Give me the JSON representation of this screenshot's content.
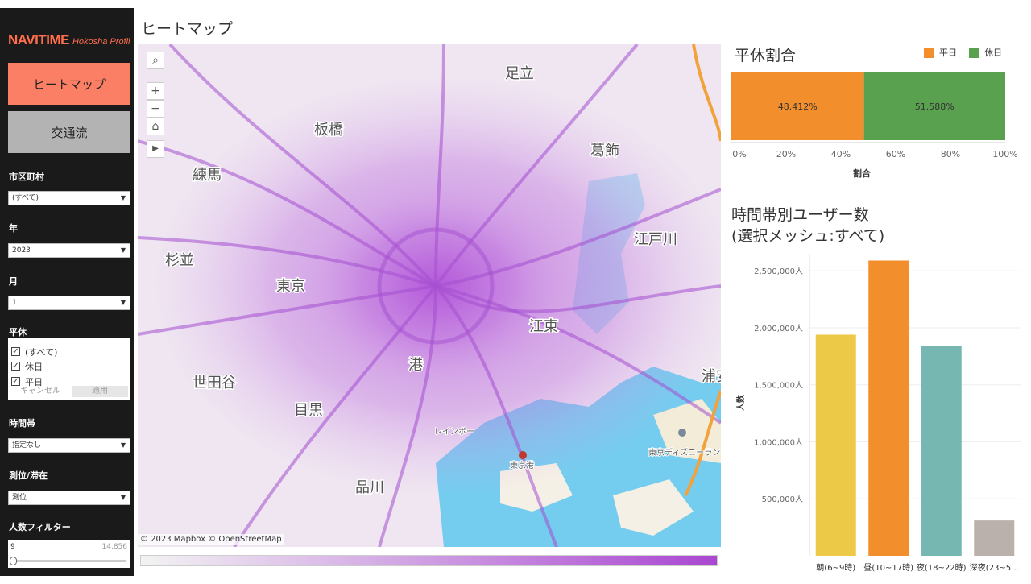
{
  "app": {
    "logo_main": "NAVITIME",
    "logo_sub": "Hokosha Profiler"
  },
  "nav": {
    "heatmap_label": "ヒートマップ",
    "flow_label": "交通流"
  },
  "filters": {
    "municipality": {
      "label": "市区町村",
      "value": "(すべて)"
    },
    "year": {
      "label": "年",
      "value": "2023"
    },
    "month": {
      "label": "月",
      "value": "1"
    },
    "weekday": {
      "label": "平休",
      "options": [
        {
          "label": "(すべて)",
          "checked": true
        },
        {
          "label": "休日",
          "checked": true
        },
        {
          "label": "平日",
          "checked": true
        }
      ],
      "cancel_label": "キャンセル",
      "apply_label": "適用"
    },
    "timeband": {
      "label": "時間帯",
      "value": "指定なし"
    },
    "measure": {
      "label": "測位/滞在",
      "value": "測位"
    },
    "people_filter": {
      "label": "人数フィルター",
      "min": "9",
      "max": "14,856"
    }
  },
  "map": {
    "title": "ヒートマップ",
    "attribution": "© 2023 Mapbox  © OpenStreetMap",
    "place_labels": [
      "足立",
      "板橋",
      "葛飾",
      "練馬",
      "江戸川",
      "杉並",
      "東京",
      "江東",
      "港",
      "世田谷",
      "浦安",
      "目黒",
      "レインボー",
      "東京港",
      "東京ディズニーランド",
      "品川"
    ],
    "legend_colors": {
      "low": "#f3f3f3",
      "high": "#a947d1"
    }
  },
  "ratio_panel": {
    "title": "平休割合",
    "legend": [
      {
        "label": "平日",
        "color": "#f28e2b"
      },
      {
        "label": "休日",
        "color": "#59a14f"
      }
    ],
    "axis_label": "割合",
    "ticks": [
      "0%",
      "20%",
      "40%",
      "60%",
      "80%",
      "100%"
    ],
    "segment_labels": [
      "48.412%",
      "51.588%"
    ]
  },
  "hourly_panel": {
    "title_line1": "時間帯別ユーザー数",
    "title_line2": "(選択メッシュ:すべて)",
    "y_label": "人数",
    "y_ticks": [
      "500,000人",
      "1,000,000人",
      "1,500,000人",
      "2,000,000人",
      "2,500,000人"
    ]
  },
  "chart_data": [
    {
      "type": "bar",
      "orientation": "horizontal-stacked",
      "categories": [
        "平日",
        "休日"
      ],
      "values": [
        48.412,
        51.588
      ],
      "xlabel": "割合",
      "xlim": [
        0,
        100
      ],
      "colors": [
        "#f28e2b",
        "#59a14f"
      ],
      "legend": "top-right"
    },
    {
      "type": "bar",
      "categories": [
        "朝(6~9時)",
        "昼(10~17時)",
        "夜(18~22時)",
        "深夜(23~5..."
      ],
      "values": [
        1940000,
        2590000,
        1840000,
        310000
      ],
      "ylabel": "人数",
      "ylim": [
        0,
        2650000
      ],
      "colors": [
        "#edc948",
        "#f28e2b",
        "#76b7b2",
        "#bab0ac"
      ],
      "grid": true
    }
  ]
}
